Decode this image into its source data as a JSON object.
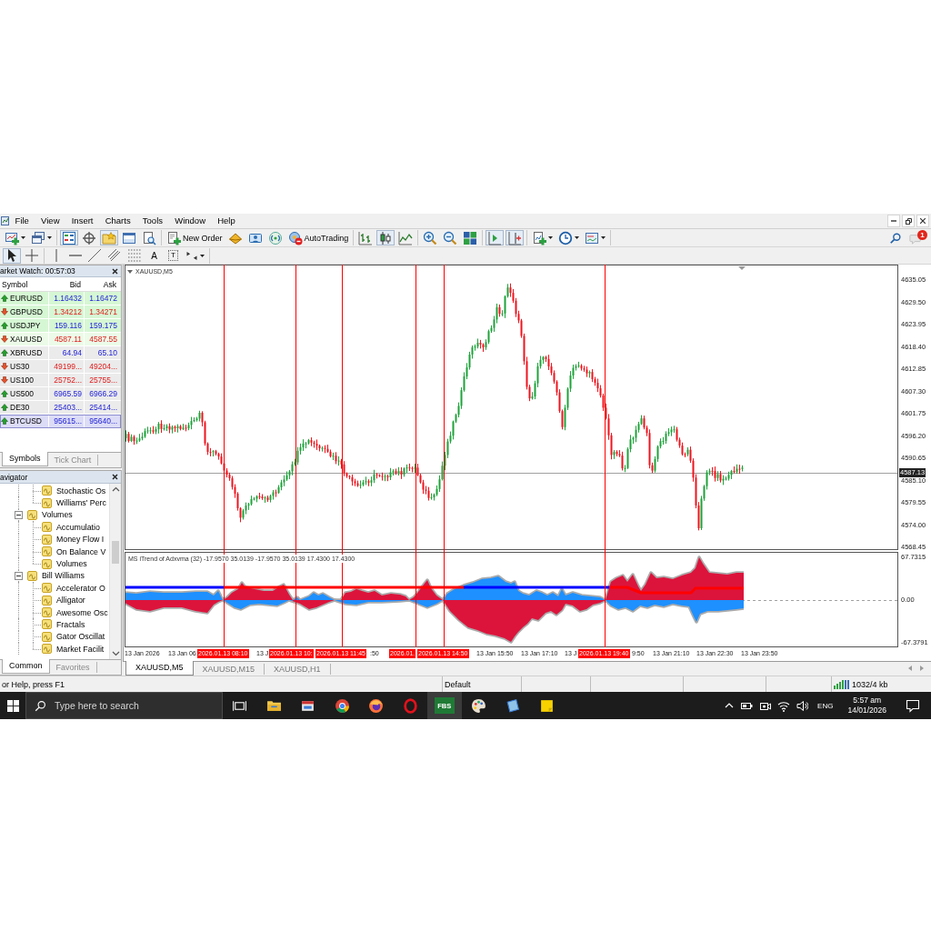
{
  "menu_bar": {
    "items": [
      "File",
      "View",
      "Insert",
      "Charts",
      "Tools",
      "Window",
      "Help"
    ]
  },
  "toolbar_1": {
    "groups": [
      [
        {
          "kind": "newchart",
          "pressed": false
        },
        {
          "kind": "profiles",
          "pressed": false
        }
      ],
      [
        {
          "kind": "marketwatch",
          "pressed": true
        },
        {
          "kind": "datawindow",
          "pressed": false
        },
        {
          "kind": "navigator",
          "pressed": true
        },
        {
          "kind": "terminal",
          "pressed": false
        },
        {
          "kind": "tester",
          "pressed": false
        }
      ],
      [
        {
          "kind": "neworder",
          "label": "New Order",
          "pressed": false
        },
        {
          "kind": "editor",
          "pressed": false
        },
        {
          "kind": "signals",
          "pressed": false
        },
        {
          "kind": "market",
          "pressed": false
        },
        {
          "kind": "autotrading",
          "label": "AutoTrading",
          "pressed": false
        }
      ],
      [
        {
          "kind": "bars",
          "pressed": false
        },
        {
          "kind": "candles",
          "pressed": true
        },
        {
          "kind": "line",
          "pressed": false
        }
      ],
      [
        {
          "kind": "zoomin",
          "pressed": false
        },
        {
          "kind": "zoomout",
          "pressed": false
        },
        {
          "kind": "tile",
          "pressed": false
        }
      ],
      [
        {
          "kind": "autoscroll",
          "pressed": true
        },
        {
          "kind": "shift",
          "pressed": true
        }
      ],
      [
        {
          "kind": "indicators",
          "pressed": false
        },
        {
          "kind": "periods",
          "pressed": false
        },
        {
          "kind": "templates",
          "pressed": false
        }
      ]
    ],
    "notification_count": "1"
  },
  "toolbar_2": {
    "groups": [
      [
        {
          "kind": "cursor",
          "pressed": true
        },
        {
          "kind": "crosshair",
          "pressed": false
        }
      ],
      [
        {
          "kind": "vline",
          "pressed": false
        },
        {
          "kind": "hline",
          "pressed": false
        },
        {
          "kind": "trendline",
          "pressed": false
        },
        {
          "kind": "channel",
          "pressed": false
        },
        {
          "kind": "fibo",
          "pressed": false
        },
        {
          "kind": "text",
          "label": "A",
          "pressed": false
        },
        {
          "kind": "label",
          "label": "T",
          "pressed": false
        },
        {
          "kind": "arrows",
          "pressed": false
        }
      ]
    ]
  },
  "market_watch": {
    "title": "arket Watch: 00:57:03",
    "columns": [
      "Symbol",
      "Bid",
      "Ask"
    ],
    "rows": [
      {
        "symbol": "EURUSD",
        "bid": "1.16432",
        "ask": "1.16472",
        "rising": true,
        "color": "#d6f7d4",
        "selected": false
      },
      {
        "symbol": "GBPUSD",
        "bid": "1.34212",
        "ask": "1.34271",
        "rising": false,
        "color": "#d6f7d4",
        "selected": false
      },
      {
        "symbol": "USDJPY",
        "bid": "159.116",
        "ask": "159.175",
        "rising": true,
        "color": "#d6f7d4",
        "selected": false
      },
      {
        "symbol": "XAUUSD",
        "bid": "4587.11",
        "ask": "4587.55",
        "rising": false,
        "color": "#ecfbe8",
        "selected": false
      },
      {
        "symbol": "XBRUSD",
        "bid": "64.94",
        "ask": "65.10",
        "rising": true,
        "color": "#ebebeb",
        "selected": false
      },
      {
        "symbol": "US30",
        "bid": "49199...",
        "ask": "49204...",
        "rising": false,
        "color": "#ebebeb",
        "selected": false
      },
      {
        "symbol": "US100",
        "bid": "25752...",
        "ask": "25755...",
        "rising": false,
        "color": "#ebebeb",
        "selected": false
      },
      {
        "symbol": "US500",
        "bid": "6965.59",
        "ask": "6966.29",
        "rising": true,
        "color": "#ebebeb",
        "selected": false
      },
      {
        "symbol": "DE30",
        "bid": "25403...",
        "ask": "25414...",
        "rising": true,
        "color": "#ebebeb",
        "selected": false
      },
      {
        "symbol": "BTCUSD",
        "bid": "95615...",
        "ask": "95640...",
        "rising": true,
        "color": "#dcdcf7",
        "selected": true
      }
    ],
    "tabs": [
      {
        "label": "Symbols",
        "selected": true
      },
      {
        "label": "Tick Chart",
        "selected": false
      }
    ]
  },
  "navigator": {
    "title": "avigator",
    "tree": [
      {
        "kind": "offscreen",
        "children": [
          {
            "kind": "indicator",
            "label": "Stochastic Os"
          },
          {
            "kind": "indicator",
            "label": "Williams' Perc"
          }
        ]
      },
      {
        "kind": "folder",
        "label": "Volumes",
        "expanded": true,
        "children": [
          {
            "kind": "indicator",
            "label": "Accumulatio"
          },
          {
            "kind": "indicator",
            "label": "Money Flow I"
          },
          {
            "kind": "indicator",
            "label": "On Balance V"
          },
          {
            "kind": "indicator",
            "label": "Volumes"
          }
        ]
      },
      {
        "kind": "folder",
        "label": "Bill Williams",
        "expanded": true,
        "children": [
          {
            "kind": "indicator",
            "label": "Accelerator O"
          },
          {
            "kind": "indicator",
            "label": "Alligator"
          },
          {
            "kind": "indicator",
            "label": "Awesome Osc"
          },
          {
            "kind": "indicator",
            "label": "Fractals"
          },
          {
            "kind": "indicator",
            "label": "Gator Oscillat"
          },
          {
            "kind": "indicator",
            "label": "Market Facilit"
          }
        ]
      }
    ],
    "tabs": [
      {
        "label": "Common",
        "selected": true
      },
      {
        "label": "Favorites",
        "selected": false
      }
    ]
  },
  "chart": {
    "title": "XAUUSD,M5",
    "price_axis": [
      "4635.05",
      "4629.50",
      "4623.95",
      "4618.40",
      "4612.85",
      "4607.30",
      "4601.75",
      "4596.20",
      "4590.65",
      "4585.10",
      "4579.55",
      "4574.00",
      "4568.45"
    ],
    "current_price": "4587.13",
    "indicator": {
      "label": "MS iTrend of Adxvma (32) -17.9570 35.0139 -17.9570 35.0139 17.4300 17.4300",
      "axis": [
        "67.7315",
        "0.00",
        "-67.3791"
      ]
    },
    "time_axis": [
      "13 Jan 2026",
      "13 Jan 06",
      "13 J",
      ":50",
      "13 Jan 15:50",
      "13 Jan 17:10",
      "13 J",
      "9:50",
      "13 Jan 21:10",
      "13 Jan 22:30",
      "13 Jan 23:50"
    ],
    "vertical_lines": [
      {
        "label": "2026.01.13 08:10"
      },
      {
        "label": "2026.01.13 10:"
      },
      {
        "label": "2026.01.13 11:45"
      },
      {
        "label": "2026.01."
      },
      {
        "label": "2026.01.13 14:50"
      },
      {
        "label": "2026.01.13 19:40"
      }
    ]
  },
  "chart_tabs": [
    {
      "label": "XAUUSD,M5",
      "selected": true
    },
    {
      "label": "XAUUSD,M15",
      "selected": false
    },
    {
      "label": "XAUUSD,H1",
      "selected": false
    }
  ],
  "status_bar": {
    "help": "or Help, press F1",
    "profile": "Default",
    "connection": "1032/4 kb"
  },
  "taskbar": {
    "search": {
      "placeholder": "Type here to search"
    },
    "apps": [
      {
        "kind": "taskview",
        "active": false
      },
      {
        "kind": "explorer",
        "active": false
      },
      {
        "kind": "window",
        "active": false
      },
      {
        "kind": "chrome",
        "active": false
      },
      {
        "kind": "firefox",
        "active": false
      },
      {
        "kind": "opera",
        "active": false
      },
      {
        "kind": "fbs",
        "label": "FBS",
        "active": true
      },
      {
        "kind": "paint",
        "active": false
      },
      {
        "kind": "card",
        "active": false
      },
      {
        "kind": "sticky",
        "active": false
      }
    ],
    "tray": {
      "language": "ENG",
      "time": "5:57 am",
      "date": "14/01/2026"
    }
  }
}
